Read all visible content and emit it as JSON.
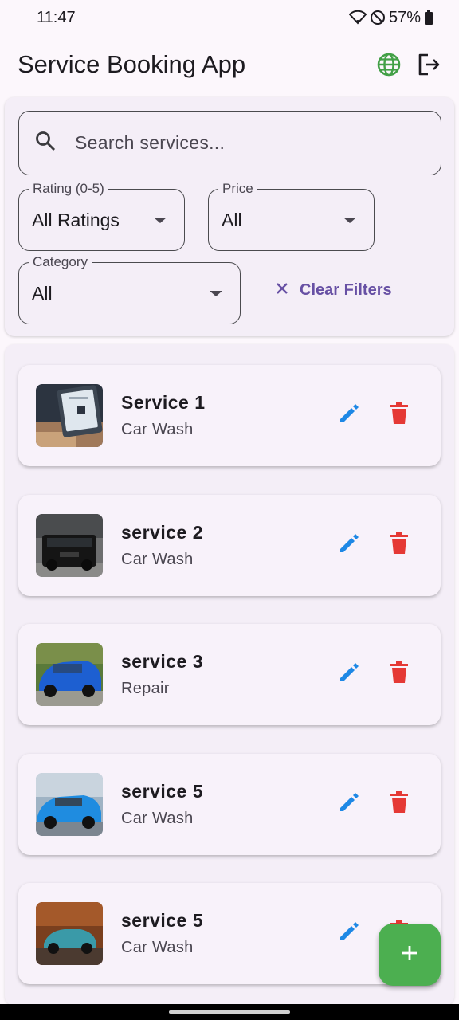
{
  "status_bar": {
    "time": "11:47",
    "battery": "57%"
  },
  "app_bar": {
    "title": "Service Booking App",
    "icons": [
      "globe-icon",
      "logout-icon"
    ]
  },
  "filters": {
    "search_placeholder": "Search services...",
    "rating": {
      "label": "Rating (0-5)",
      "value": "All Ratings"
    },
    "price": {
      "label": "Price",
      "value": "All"
    },
    "category": {
      "label": "Category",
      "value": "All"
    },
    "clear_label": "Clear Filters"
  },
  "services": [
    {
      "name": "Service 1",
      "category": "Car Wash"
    },
    {
      "name": "service 2",
      "category": "Car Wash"
    },
    {
      "name": "service 3",
      "category": "Repair"
    },
    {
      "name": "service 5",
      "category": "Car Wash"
    },
    {
      "name": "service 5",
      "category": "Car Wash"
    }
  ],
  "colors": {
    "accent": "#6750a4",
    "edit": "#1e88e5",
    "delete": "#e53935",
    "fab": "#4caf50",
    "globe": "#43a047"
  }
}
